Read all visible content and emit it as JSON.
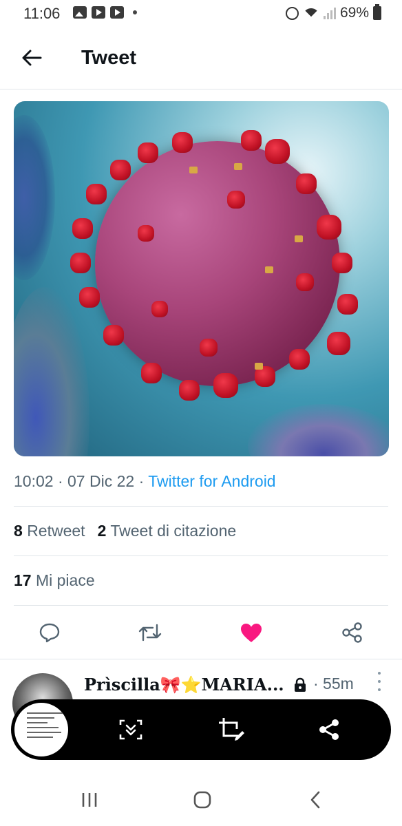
{
  "status_bar": {
    "time": "11:06",
    "battery": "69%"
  },
  "header": {
    "title": "Tweet"
  },
  "tweet": {
    "time": "10:02",
    "separator": "·",
    "date": "07 Dic 22",
    "source": "Twitter for Android",
    "retweets_count": "8",
    "retweets_label": "Retweet",
    "quotes_count": "2",
    "quotes_label": "Tweet di citazione",
    "likes_count": "17",
    "likes_label": "Mi piace",
    "liked": true,
    "like_color": "#f91880",
    "link_color": "#1d9bf0"
  },
  "reply": {
    "name": "Prìscilla🎀⭐MARIA...",
    "time": "· 55m"
  },
  "icons": [
    "back-arrow-icon",
    "reply-icon",
    "retweet-icon",
    "heart-icon",
    "share-icon",
    "lock-icon",
    "more-icon",
    "scroll-capture-icon",
    "crop-edit-icon",
    "share-icon",
    "recent-apps-icon",
    "home-icon",
    "back-icon"
  ]
}
